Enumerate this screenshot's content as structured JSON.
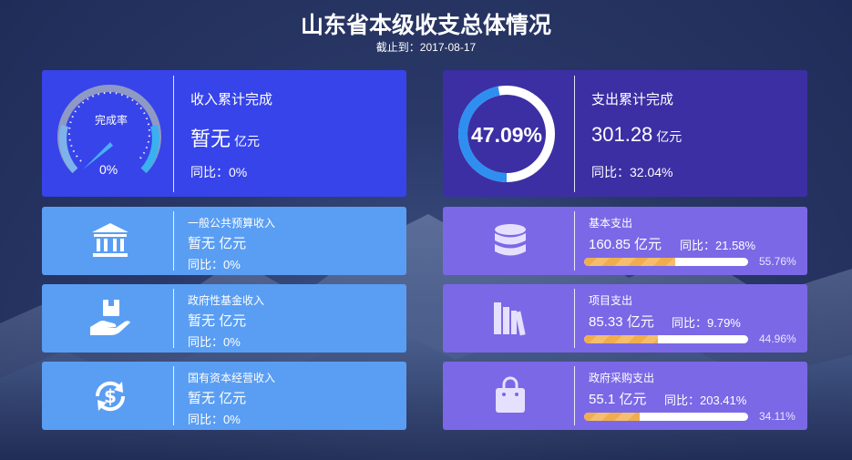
{
  "header": {
    "title": "山东省本级收支总体情况",
    "subtitle": "截止到：2017-08-17"
  },
  "income_summary": {
    "gauge_label": "完成率",
    "gauge_value_text": "0%",
    "label": "收入累计完成",
    "value": "暂无",
    "unit": "亿元",
    "yoy": "同比：0%",
    "completion_rate": 0
  },
  "expense_summary": {
    "ring_text": "47.09%",
    "completion_rate": 47.09,
    "label": "支出累计完成",
    "value": "301.28",
    "unit": "亿元",
    "yoy": "同比：32.04%"
  },
  "income_items": [
    {
      "label": "一般公共预算收入",
      "value": "暂无 亿元",
      "yoy": "同比：0%",
      "icon": "bank-icon"
    },
    {
      "label": "政府性基金收入",
      "value": "暂无 亿元",
      "yoy": "同比：0%",
      "icon": "hand-box-icon"
    },
    {
      "label": "国有资本经营收入",
      "value": "暂无 亿元",
      "yoy": "同比：0%",
      "icon": "dollar-cycle-icon"
    }
  ],
  "expense_items": [
    {
      "label": "基本支出",
      "value": "160.85 亿元",
      "yoy": "同比：21.58%",
      "percent_text": "55.76%",
      "percent": 55.76,
      "icon": "database-icon"
    },
    {
      "label": "项目支出",
      "value": "85.33 亿元",
      "yoy": "同比：9.79%",
      "percent_text": "44.96%",
      "percent": 44.96,
      "icon": "books-icon"
    },
    {
      "label": "政府采购支出",
      "value": "55.1 亿元",
      "yoy": "同比：203.41%",
      "percent_text": "34.11%",
      "percent": 34.11,
      "icon": "shopping-bag-icon"
    }
  ],
  "colors": {
    "income_summary_bg": "#3744ea",
    "expense_summary_bg": "#3c2fa4",
    "income_item_bg": "#5a9ef3",
    "expense_item_bg": "#7b68e6",
    "progress_fill": "#f0ad4e",
    "ring_fill": "#2e8ff0"
  }
}
